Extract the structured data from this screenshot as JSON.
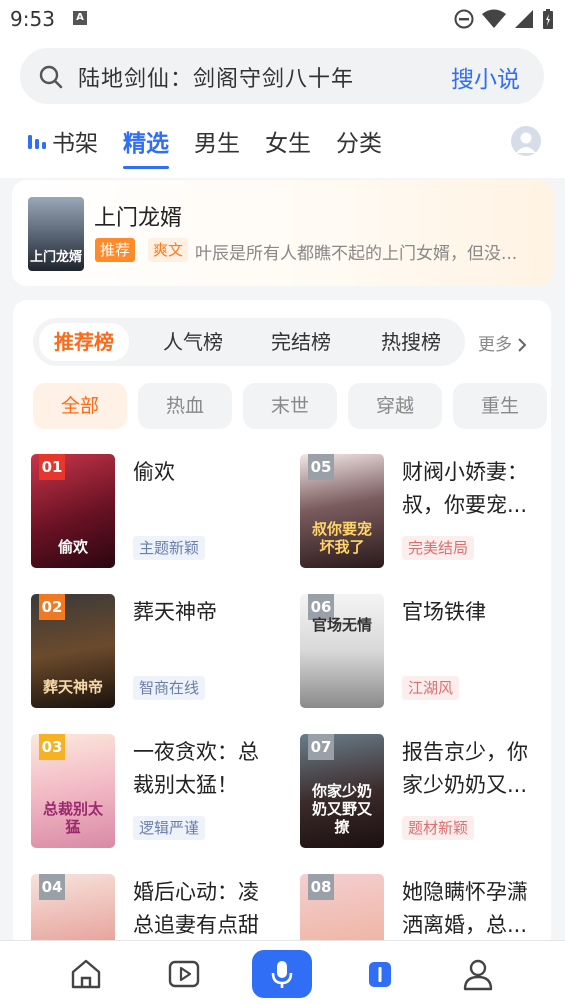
{
  "status": {
    "time": "9:53",
    "a_label": "A"
  },
  "search": {
    "text": "陆地剑仙：剑阁守剑八十年",
    "button": "搜小说"
  },
  "tabs": [
    "书架",
    "精选",
    "男生",
    "女生",
    "分类"
  ],
  "promo": {
    "title": "上门龙婿",
    "cover_text": "上门龙婿",
    "badge1": "推荐",
    "badge2": "爽文",
    "desc": "叶辰是所有人都瞧不起的上门女婿，但没..."
  },
  "rank_tabs": [
    "推荐榜",
    "人气榜",
    "完结榜",
    "热搜榜"
  ],
  "rank_more": "更多",
  "chips": [
    "全部",
    "热血",
    "末世",
    "穿越",
    "重生"
  ],
  "books": [
    {
      "num": "01",
      "title": "偷欢",
      "tag": "主题新颖",
      "cover_text": "偷欢"
    },
    {
      "num": "05",
      "title": "财阀小娇妻：叔，你要宠...",
      "tag": "完美结局",
      "cover_text": "叔你要宠坏我了"
    },
    {
      "num": "02",
      "title": "葬天神帝",
      "tag": "智商在线",
      "cover_text": "葬天神帝"
    },
    {
      "num": "06",
      "title": "官场铁律",
      "tag": "江湖风",
      "cover_text": "官场无情"
    },
    {
      "num": "03",
      "title": "一夜贪欢：总裁别太猛！",
      "tag": "逻辑严谨",
      "cover_text": "总裁别太猛"
    },
    {
      "num": "07",
      "title": "报告京少，你家少奶奶又...",
      "tag": "题材新颖",
      "cover_text": "你家少奶奶又野又撩"
    },
    {
      "num": "04",
      "title": "婚后心动：凌总追妻有点甜",
      "tag": "",
      "cover_text": ""
    },
    {
      "num": "08",
      "title": "她隐瞒怀孕潇洒离婚，总...",
      "tag": "",
      "cover_text": ""
    }
  ],
  "colors": {
    "accent": "#2f6ef5",
    "orange": "#ff6a1a"
  }
}
